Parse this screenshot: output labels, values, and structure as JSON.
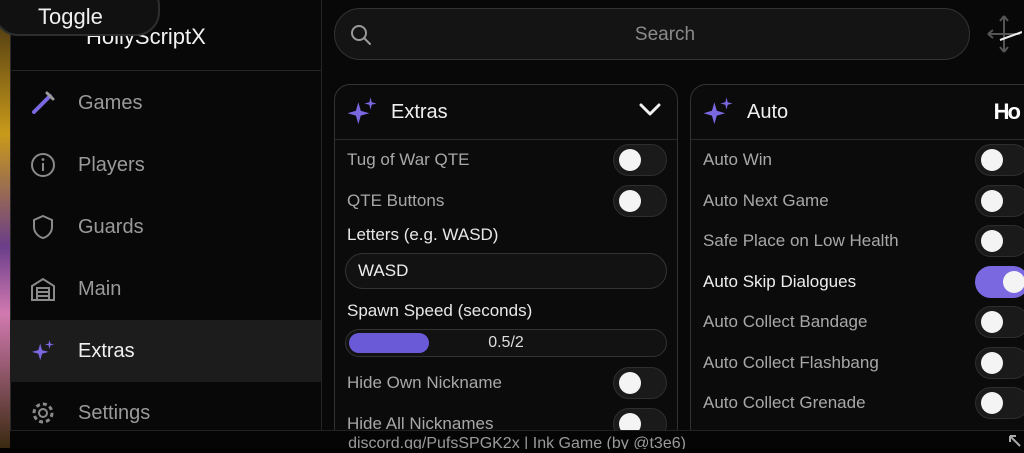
{
  "app": {
    "title": "HollyScriptX",
    "toggle_label": "Toggle"
  },
  "search": {
    "placeholder": "Search"
  },
  "sidebar": {
    "items": [
      {
        "label": "Games",
        "icon": "wand-icon"
      },
      {
        "label": "Players",
        "icon": "info-icon"
      },
      {
        "label": "Guards",
        "icon": "shield-icon"
      },
      {
        "label": "Main",
        "icon": "garage-icon"
      },
      {
        "label": "Extras",
        "icon": "sparkles-icon",
        "active": true
      },
      {
        "label": "Settings",
        "icon": "gear-icon"
      }
    ]
  },
  "panels": {
    "extras": {
      "title": "Extras",
      "toggles_top": [
        {
          "label": "Tug of War QTE",
          "on": false
        },
        {
          "label": "QTE Buttons",
          "on": false
        }
      ],
      "letters": {
        "label": "Letters (e.g. WASD)",
        "value": "WASD"
      },
      "spawn": {
        "label": "Spawn Speed (seconds)",
        "value_text": "0.5/2",
        "fraction": 0.25
      },
      "toggles_bottom": [
        {
          "label": "Hide Own Nickname",
          "on": false
        },
        {
          "label": "Hide All Nicknames",
          "on": false
        }
      ]
    },
    "auto": {
      "title": "Auto",
      "hint": "Ho",
      "toggles": [
        {
          "label": "Auto Win",
          "on": false
        },
        {
          "label": "Auto Next Game",
          "on": false
        },
        {
          "label": "Safe Place on Low Health",
          "on": false
        },
        {
          "label": "Auto Skip Dialogues",
          "on": true
        },
        {
          "label": "Auto Collect Bandage",
          "on": false
        },
        {
          "label": "Auto Collect Flashbang",
          "on": false
        },
        {
          "label": "Auto Collect Grenade",
          "on": false
        }
      ]
    }
  },
  "footer": {
    "text": "discord.gg/PufsSPGK2x | Ink Game (by @t3e6)"
  },
  "colors": {
    "accent": "#7a68e0",
    "background": "#080808"
  }
}
